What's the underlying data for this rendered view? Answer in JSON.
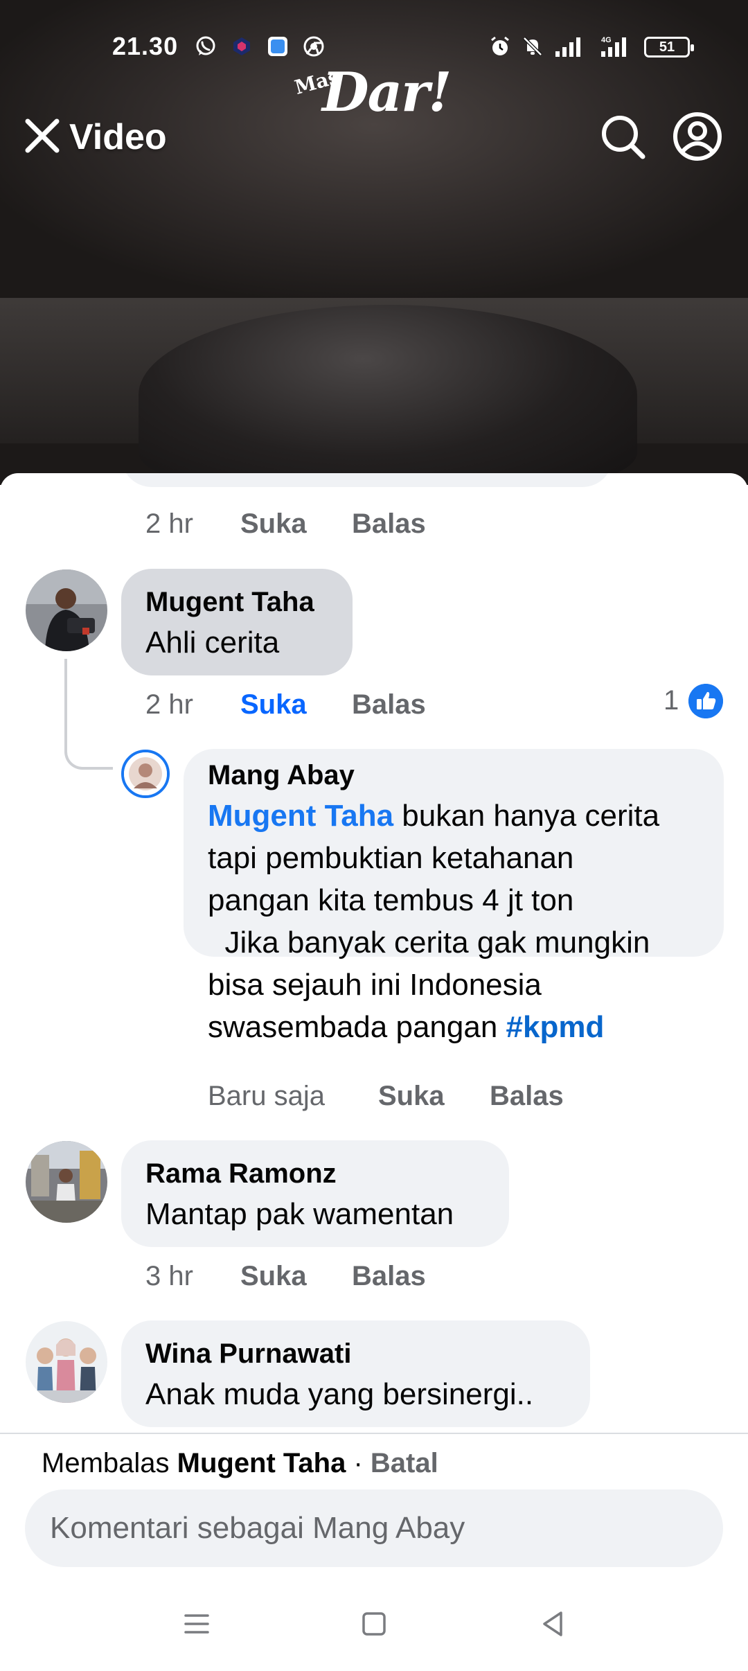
{
  "status_bar": {
    "time": "21.30",
    "battery": "51",
    "network": "4G"
  },
  "top_nav": {
    "title": "Video",
    "logo_small": "Mas",
    "logo_big": "Dar!"
  },
  "comments": [
    {
      "meta": {
        "time": "2 hr",
        "like": "Suka",
        "reply": "Balas"
      }
    },
    {
      "author": "Mugent Taha",
      "text": "Ahli cerita",
      "meta": {
        "time": "2 hr",
        "like": "Suka",
        "reply": "Balas"
      },
      "like_count": "1"
    },
    {
      "author": "Mang Abay",
      "mention": "Mugent Taha",
      "text_lines": [
        " bukan hanya cerita",
        "tapi pembuktian ketahanan",
        "pangan kita tembus 4 jt ton",
        "  Jika banyak cerita gak mungkin",
        "bisa sejauh ini Indonesia",
        "swasembada pangan "
      ],
      "hashtag": "#kpmd",
      "meta": {
        "time": "Baru saja",
        "like": "Suka",
        "reply": "Balas"
      }
    },
    {
      "author": "Rama Ramonz",
      "text": "Mantap pak wamentan",
      "meta": {
        "time": "3 hr",
        "like": "Suka",
        "reply": "Balas"
      }
    },
    {
      "author": "Wina Purnawati",
      "text": "Anak muda yang bersinergi.."
    }
  ],
  "reply_bar": {
    "prefix": "Membalas ",
    "name": "Mugent Taha",
    "separator": " · ",
    "cancel": "Batal",
    "placeholder": "Komentari sebagai Mang Abay"
  },
  "colors": {
    "accent": "#1877f2",
    "bubble": "#f0f2f5",
    "bubble_highlight": "#d8dadf",
    "secondary_text": "#65676b"
  },
  "icons": [
    "whatsapp-icon",
    "app-icon",
    "chrome-icon",
    "alarm-icon",
    "mute-icon",
    "signal-icon",
    "battery-icon",
    "close-icon",
    "search-icon",
    "profile-icon",
    "like-icon",
    "menu-icon",
    "home-icon",
    "back-icon"
  ]
}
